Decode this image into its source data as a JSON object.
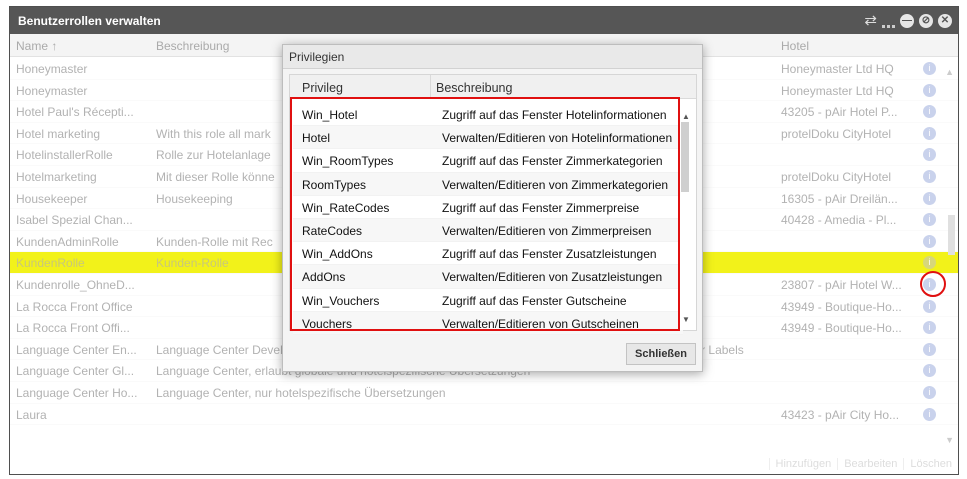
{
  "window": {
    "title": "Benutzerrollen verwalten",
    "buttons": [
      "minimize",
      "maximize",
      "close"
    ]
  },
  "grid": {
    "columns": [
      "Name ↑",
      "Beschreibung",
      "Hotel"
    ],
    "rows": [
      {
        "name": "Honeymaster",
        "desc": "",
        "hotel": "Honeymaster Ltd HQ"
      },
      {
        "name": "Honeymaster",
        "desc": "",
        "hotel": "Honeymaster Ltd HQ"
      },
      {
        "name": "Hotel Paul's Récepti...",
        "desc": "",
        "hotel": "43205 - pAir Hotel P..."
      },
      {
        "name": "Hotel marketing",
        "desc": "With this role all mark",
        "hotel": "protelDoku CityHotel"
      },
      {
        "name": "HotelinstallerRolle",
        "desc": "Rolle zur Hotelanlage",
        "hotel": ""
      },
      {
        "name": "Hotelmarketing",
        "desc": "Mit dieser Rolle könne",
        "hotel": "protelDoku CityHotel"
      },
      {
        "name": "Housekeeper",
        "desc": "Housekeeping",
        "hotel": "16305 - pAir Dreilän..."
      },
      {
        "name": "Isabel Spezial Chan...",
        "desc": "",
        "hotel": "40428 - Amedia - Pl..."
      },
      {
        "name": "KundenAdminRolle",
        "desc": "Kunden-Rolle mit Rec",
        "hotel": ""
      },
      {
        "name": "KundenRolle",
        "desc": "Kunden-Rolle",
        "hotel": "",
        "selected": true
      },
      {
        "name": "Kundenrolle_OhneD...",
        "desc": "",
        "hotel": "23807 - pAir Hotel W..."
      },
      {
        "name": "La Rocca Front Office",
        "desc": "",
        "hotel": "43949 - Boutique-Ho..."
      },
      {
        "name": "La Rocca Front Offi...",
        "desc": "",
        "hotel": "43949 - Boutique-Ho..."
      },
      {
        "name": "Language Center En...",
        "desc": "Language Center Developer, erlaubt globale und hotelspezifische Übersetzungen und die Anlage neuer Labels",
        "hotel": ""
      },
      {
        "name": "Language Center Gl...",
        "desc": "Language Center, erlaubt globale und hotelspezifische Übersetzungen",
        "hotel": ""
      },
      {
        "name": "Language Center Ho...",
        "desc": "Language Center, nur hotelspezifische Übersetzungen",
        "hotel": ""
      },
      {
        "name": "Laura",
        "desc": "",
        "hotel": "43423 - pAir City Ho..."
      }
    ],
    "info_icon": "info-icon"
  },
  "toolbar": {
    "add": "Hinzufügen",
    "edit": "Bearbeiten",
    "delete": "Löschen"
  },
  "dialog": {
    "title": "Privilegien",
    "columns": [
      "Privileg",
      "Beschreibung"
    ],
    "rows": [
      {
        "priv": "Win_Hotel",
        "desc": "Zugriff auf das Fenster Hotelinformationen"
      },
      {
        "priv": "Hotel",
        "desc": "Verwalten/Editieren von Hotelinformationen"
      },
      {
        "priv": "Win_RoomTypes",
        "desc": "Zugriff auf das Fenster Zimmerkategorien"
      },
      {
        "priv": "RoomTypes",
        "desc": "Verwalten/Editieren von Zimmerkategorien"
      },
      {
        "priv": "Win_RateCodes",
        "desc": "Zugriff auf das Fenster Zimmerpreise"
      },
      {
        "priv": "RateCodes",
        "desc": "Verwalten/Editieren von Zimmerpreisen"
      },
      {
        "priv": "Win_AddOns",
        "desc": "Zugriff auf das Fenster Zusatzleistungen"
      },
      {
        "priv": "AddOns",
        "desc": "Verwalten/Editieren von Zusatzleistungen"
      },
      {
        "priv": "Win_Vouchers",
        "desc": "Zugriff auf das Fenster Gutscheine"
      },
      {
        "priv": "Vouchers",
        "desc": "Verwalten/Editieren von Gutscheinen"
      }
    ],
    "close_label": "Schließen"
  },
  "colors": {
    "titlebar": "#565656",
    "selection": "#f2f21a",
    "highlight": "#e01010"
  }
}
